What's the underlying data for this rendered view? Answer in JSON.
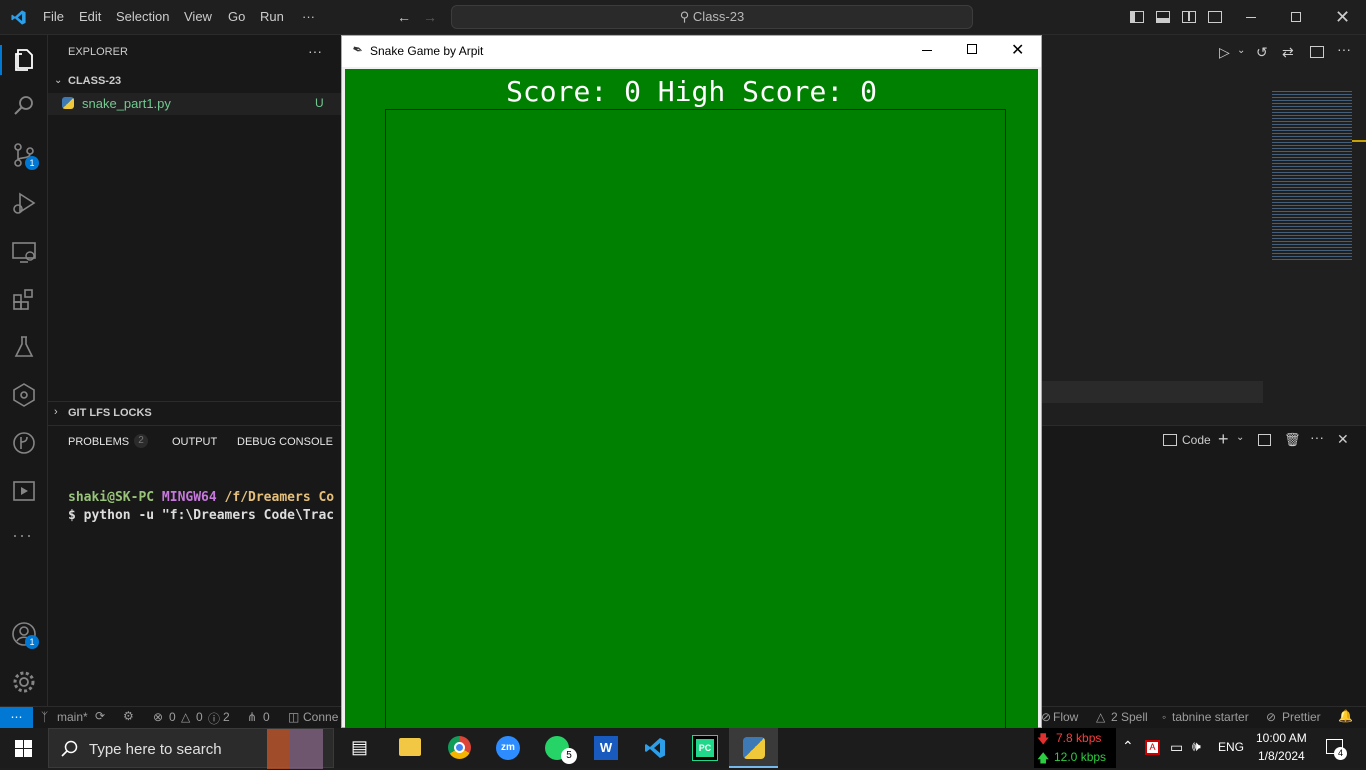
{
  "titlebar": {
    "menu": [
      "File",
      "Edit",
      "Selection",
      "View",
      "Go",
      "Run",
      "···"
    ],
    "search": "Class-23"
  },
  "activity_badges": {
    "source_control": "1",
    "accounts": "1"
  },
  "sidebar": {
    "header": "EXPLORER",
    "more": "···",
    "folder": "CLASS-23",
    "file": {
      "name": "snake_part1.py",
      "status": "U"
    },
    "lfs": "GIT LFS LOCKS"
  },
  "panel": {
    "tabs": {
      "problems": "PROBLEMS",
      "problems_count": "2",
      "output": "OUTPUT",
      "debug": "DEBUG CONSOLE"
    },
    "terminal_name": "Code",
    "prompt": {
      "user": "shaki@SK-PC",
      "env": "MINGW64",
      "path": "/f/Dreamers Co"
    },
    "command": "$ python -u \"f:\\Dreamers Code\\Trac"
  },
  "statusbar": {
    "branch": "main*",
    "errors": "0",
    "warnings": "0",
    "info": "2",
    "ports": "0",
    "connect": "Conne",
    "flow": "Flow",
    "spell": "2 Spell",
    "tabnine": "tabnine starter",
    "prettier": "Prettier"
  },
  "snake": {
    "title": "Snake Game by Arpit",
    "score_text": "Score: 0 High Score: 0"
  },
  "taskbar": {
    "search_placeholder": "Type here to search",
    "whatsapp_count": "5",
    "net_down": "7.8 kbps",
    "net_up": "12.0 kbps",
    "lang": "ENG",
    "time": "10:00 AM",
    "date": "1/8/2024",
    "notifications": "4"
  },
  "colors": {
    "accent": "#0078d4",
    "game_bg": "#008000"
  }
}
